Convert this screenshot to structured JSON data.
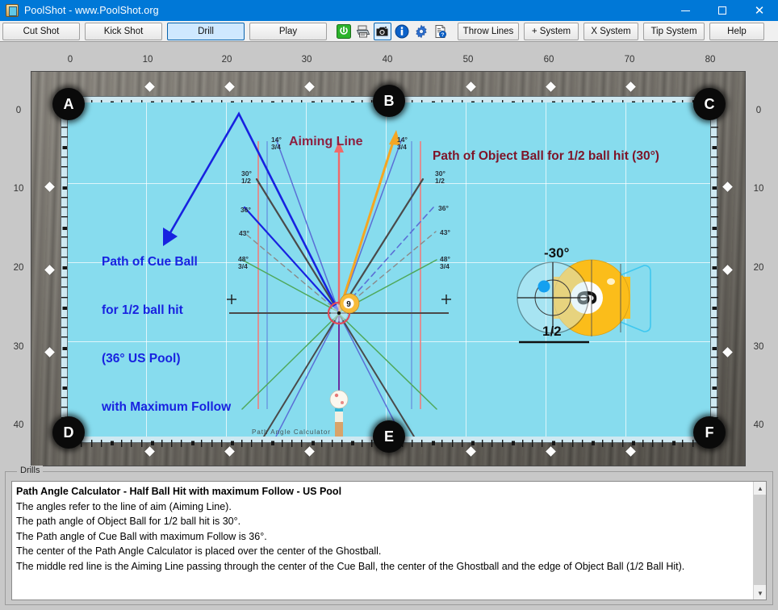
{
  "window": {
    "title": "PoolShot - www.PoolShot.org",
    "app_icon": "pool-table-icon",
    "controls": {
      "minimize": "minimize-icon",
      "maximize": "maximize-icon",
      "close": "close-icon"
    }
  },
  "toolbar": {
    "buttons": [
      {
        "label": "Cut Shot",
        "active": false
      },
      {
        "label": "Kick Shot",
        "active": false
      },
      {
        "label": "Drill",
        "active": true
      },
      {
        "label": "Play",
        "active": false
      }
    ],
    "icons": [
      {
        "name": "power-icon",
        "selected": false
      },
      {
        "name": "printer-icon",
        "selected": false
      },
      {
        "name": "camera-icon",
        "selected": true
      },
      {
        "name": "info-icon",
        "selected": false
      },
      {
        "name": "settings-gear-icon",
        "selected": false
      },
      {
        "name": "help-document-icon",
        "selected": false
      }
    ],
    "right_buttons": [
      {
        "label": "Throw Lines"
      },
      {
        "label": "+ System"
      },
      {
        "label": "X System"
      },
      {
        "label": "Tip System"
      },
      {
        "label": "Help"
      }
    ]
  },
  "table": {
    "ruler_top": [
      "0",
      "10",
      "20",
      "30",
      "40",
      "50",
      "60",
      "70",
      "80"
    ],
    "ruler_left": [
      "0",
      "10",
      "20",
      "30",
      "40"
    ],
    "ruler_right": [
      "0",
      "10",
      "20",
      "30",
      "40"
    ],
    "pockets": [
      {
        "label": "A",
        "position": "top-left"
      },
      {
        "label": "B",
        "position": "top-center"
      },
      {
        "label": "C",
        "position": "top-right"
      },
      {
        "label": "D",
        "position": "bottom-left"
      },
      {
        "label": "E",
        "position": "bottom-center"
      },
      {
        "label": "F",
        "position": "bottom-right"
      }
    ],
    "annotations": {
      "aiming_line": "Aiming Line",
      "object_ball_path": "Path of Object Ball for 1/2 ball hit (30°)",
      "cue_ball_path_line1": "Path of Cue Ball",
      "cue_ball_path_line2": "for 1/2 ball hit",
      "cue_ball_path_line3": "(36° US Pool)",
      "cue_ball_path_line4": "with Maximum Follow",
      "rail_text": "Path  Angle  Calculator"
    },
    "angle_labels_left": [
      "14°\n3/4",
      "30°\n1/2",
      "36°",
      "43°",
      "48°\n3/4"
    ],
    "angle_labels_right": [
      "14°\n3/4",
      "30°\n1/2",
      "36°",
      "43°",
      "48°\n3/4"
    ],
    "ball_diagram": {
      "angle": "-30°",
      "fraction": "1/2",
      "object_ball_number": "9",
      "tip_position": "upper-left-english"
    },
    "colors": {
      "cloth": "#87dcee",
      "aiming_line": "#e8646c",
      "cue_ball_path": "#1822e0",
      "object_ball_path": "#f5a623",
      "path_angle_calc": "#4a4a4a",
      "secondary_blue": "#4a5fd8",
      "secondary_green": "#4fa85a",
      "annotation_dark_red": "#7e1428"
    }
  },
  "drills": {
    "legend": "Drills",
    "lines": [
      "Path Angle Calculator - Half Ball Hit with maximum Follow - US Pool",
      "The angles refer to the line of aim (Aiming Line).",
      "The path angle of Object Ball for 1/2 ball hit is 30°.",
      "The Path angle of Cue Ball with maximum Follow is 36°.",
      "The center of the Path Angle Calculator is placed over the center of the Ghostball.",
      "The middle red line is the Aiming Line passing through the center of the Cue Ball, the center of the Ghostball and the edge of Object Ball (1/2 Ball Hit)."
    ],
    "scrollbar": {
      "up": "scroll-up-arrow",
      "down": "scroll-down-arrow"
    }
  }
}
